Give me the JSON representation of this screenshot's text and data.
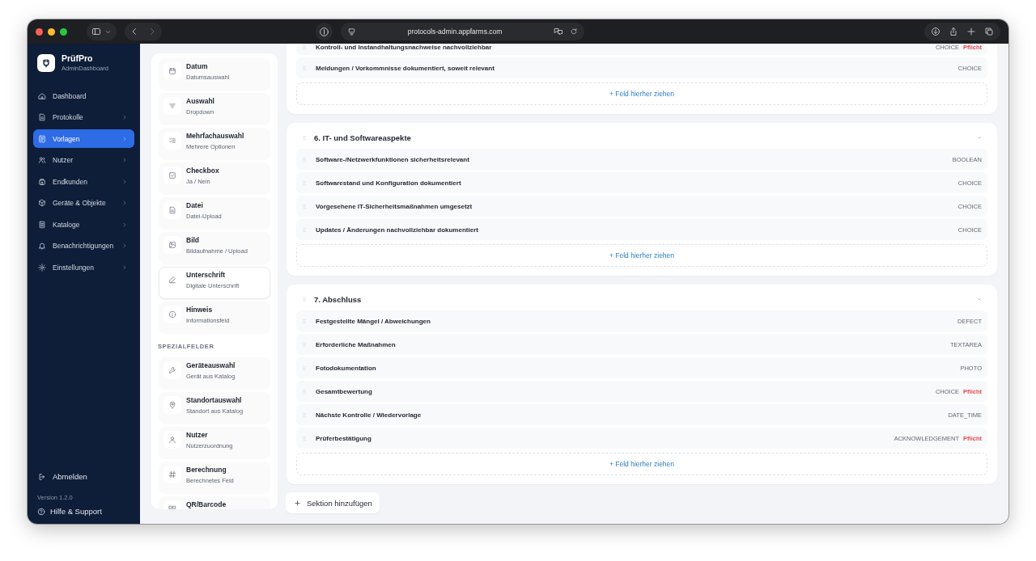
{
  "browser": {
    "url": "protocols-admin.appfarms.com"
  },
  "app": {
    "name": "PrüfPro",
    "subtitle": "AdminDashboard"
  },
  "nav": [
    {
      "kind": "home",
      "label": "Dashboard",
      "selected": false,
      "expandable": false
    },
    {
      "kind": "file",
      "label": "Protokolle",
      "selected": false,
      "expandable": true
    },
    {
      "kind": "template",
      "label": "Vorlagen",
      "selected": true,
      "expandable": true
    },
    {
      "kind": "users",
      "label": "Nutzer",
      "selected": false,
      "expandable": true
    },
    {
      "kind": "building",
      "label": "Endkunden",
      "selected": false,
      "expandable": true
    },
    {
      "kind": "box",
      "label": "Geräte & Objekte",
      "selected": false,
      "expandable": true
    },
    {
      "kind": "catalog",
      "label": "Kataloge",
      "selected": false,
      "expandable": true
    },
    {
      "kind": "bell",
      "label": "Benachrichtigungen",
      "selected": false,
      "expandable": true
    },
    {
      "kind": "gear",
      "label": "Einstellungen",
      "selected": false,
      "expandable": true
    }
  ],
  "logout": "Abmelden",
  "version": "Version 1.2.0",
  "help": "Hilfe & Support",
  "palette": [
    {
      "items": [
        {
          "kind": "date",
          "title": "Datum",
          "subtitle": "Datumsauswahl",
          "selected": false
        },
        {
          "kind": "select",
          "title": "Auswahl",
          "subtitle": "Dropdown",
          "selected": false
        },
        {
          "kind": "multi",
          "title": "Mehrfachauswahl",
          "subtitle": "Mehrere Optionen",
          "selected": false
        },
        {
          "kind": "checkbox",
          "title": "Checkbox",
          "subtitle": "Ja / Nein",
          "selected": false
        },
        {
          "kind": "file",
          "title": "Datei",
          "subtitle": "Datei-Upload",
          "selected": false
        },
        {
          "kind": "image",
          "title": "Bild",
          "subtitle": "Bildaufnahme / Upload",
          "selected": false
        },
        {
          "kind": "signature",
          "title": "Unterschrift",
          "subtitle": "Digitale Unterschrift",
          "selected": true
        },
        {
          "kind": "info",
          "title": "Hinweis",
          "subtitle": "Informationsfeld",
          "selected": false
        }
      ]
    },
    {
      "heading": "SPEZIALFELDER",
      "items": [
        {
          "kind": "device",
          "title": "Geräteauswahl",
          "subtitle": "Gerät aus Katalog",
          "selected": false
        },
        {
          "kind": "location",
          "title": "Standortauswahl",
          "subtitle": "Standort aus Katalog",
          "selected": false
        },
        {
          "kind": "user",
          "title": "Nutzer",
          "subtitle": "Nutzerzuordnung",
          "selected": false
        },
        {
          "kind": "calc",
          "title": "Berechnung",
          "subtitle": "Berechnetes Feld",
          "selected": false
        },
        {
          "kind": "qr",
          "title": "QR/Barcode",
          "selected": false
        }
      ]
    }
  ],
  "sections": [
    {
      "fields": [
        {
          "label": "Kontroll- und Instandhaltungsnachweise nachvollziehbar",
          "type": "CHOICE",
          "required": true,
          "required_label": "Pflicht"
        },
        {
          "label": "Meldungen / Vorkommnisse dokumentiert, soweit relevant",
          "type": "CHOICE",
          "required": false
        }
      ],
      "drop_label": "+ Feld hierher ziehen"
    },
    {
      "title": "6. IT- und Softwareaspekte",
      "expanded": true,
      "fields": [
        {
          "label": "Software-/Netzwerkfunktionen sicherheitsrelevant",
          "type": "BOOLEAN",
          "required": false
        },
        {
          "label": "Softwarestand und Konfiguration dokumentiert",
          "type": "CHOICE",
          "required": false
        },
        {
          "label": "Vorgesehene IT-Sicherheitsmaßnahmen umgesetzt",
          "type": "CHOICE",
          "required": false
        },
        {
          "label": "Updates / Änderungen nachvollziehbar dokumentiert",
          "type": "CHOICE",
          "required": false
        }
      ],
      "drop_label": "+ Feld hierher ziehen"
    },
    {
      "title": "7. Abschluss",
      "expanded": true,
      "fields": [
        {
          "label": "Festgestellte Mängel / Abweichungen",
          "type": "DEFECT",
          "required": false
        },
        {
          "label": "Erforderliche Maßnahmen",
          "type": "TEXTAREA",
          "required": false
        },
        {
          "label": "Fotodokumentation",
          "type": "PHOTO",
          "required": false
        },
        {
          "label": "Gesamtbewertung",
          "type": "CHOICE",
          "required": true,
          "required_label": "Pflicht"
        },
        {
          "label": "Nächste Kontrolle / Wiedervorlage",
          "type": "DATE_TIME",
          "required": false
        },
        {
          "label": "Prüferbestätigung",
          "type": "ACKNOWLEDGEMENT",
          "required": true,
          "required_label": "Pflicht"
        }
      ],
      "drop_label": "+ Feld hierher ziehen"
    }
  ],
  "add_section": "Sektion hinzufügen"
}
